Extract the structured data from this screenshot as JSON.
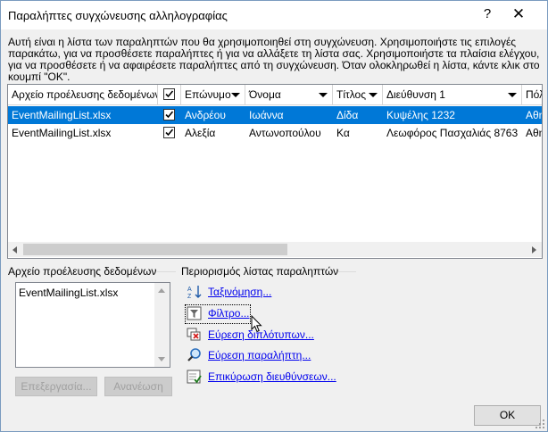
{
  "window": {
    "title": "Παραλήπτες συγχώνευσης αλληλογραφίας",
    "help_label": "?",
    "close_label": "✕"
  },
  "description": "Αυτή είναι η λίστα των παραληπτών που θα χρησιμοποιηθεί στη συγχώνευση. Χρησιμοποιήστε τις επιλογές παρακάτω, για να προσθέσετε παραλήπτες ή για να αλλάξετε τη λίστα σας. Χρησιμοποιήστε τα πλαίσια ελέγχου, για να προσθέσετε ή να αφαιρέσετε παραλήπτες από τη συγχώνευση. Όταν ολοκληρωθεί η λίστα, κάντε κλικ στο κουμπί \"OK\".",
  "grid": {
    "columns": {
      "source": "Αρχείο προέλευσης δεδομένων",
      "last_name": "Επώνυμο",
      "first_name": "Όνομα",
      "title": "Τίτλος",
      "address": "Διεύθυνση 1",
      "city": "Πόλη"
    },
    "rows": [
      {
        "source": "EventMailingList.xlsx",
        "checked": true,
        "last_name": "Ανδρέου",
        "first_name": "Ιωάννα",
        "title": "Δίδα",
        "address": "Κυψέλης 1232",
        "city": "Αθηνα",
        "selected": true
      },
      {
        "source": "EventMailingList.xlsx",
        "checked": true,
        "last_name": "Αλεξία",
        "first_name": "Αντωνοπούλου",
        "title": "Κα",
        "address": "Λεωφόρος Πασχαλιάς 8763",
        "city": "Αθηνα",
        "selected": false
      }
    ]
  },
  "source_panel": {
    "label": "Αρχείο προέλευσης δεδομένων",
    "items": [
      "EventMailingList.xlsx"
    ],
    "edit_button": "Επεξεργασία...",
    "refresh_button": "Ανανέωση"
  },
  "refine_panel": {
    "label": "Περιορισμός λίστας παραληπτών",
    "links": {
      "sort": "Ταξινόμηση...",
      "filter": "Φίλτρο...",
      "duplicates": "Εύρεση διπλότυπων...",
      "find": "Εύρεση παραλήπτη...",
      "validate": "Επικύρωση διευθύνσεων..."
    }
  },
  "ok_button": "OK",
  "colors": {
    "selection": "#0078d7",
    "link": "#0000ee"
  }
}
